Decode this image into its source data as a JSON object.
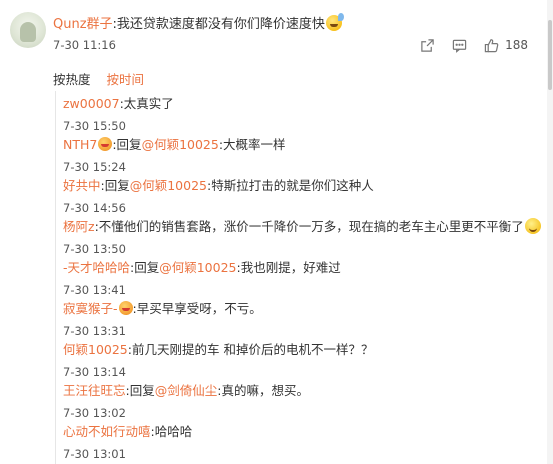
{
  "main_comment": {
    "user": "Qunz群子",
    "text": ":我还贷款速度都没有你们降价速度快",
    "time": "7-30 11:16",
    "likes": "188",
    "emoji": "sweat-grin-emoji"
  },
  "sort": {
    "by_heat": "按热度",
    "by_time": "按时间"
  },
  "replies": [
    {
      "user": "zw00007",
      "pre": ":太真实了",
      "mention": "",
      "text": "",
      "time": "7-30 15:50"
    },
    {
      "user": "NTH7",
      "pre": ":回复",
      "mention": "@何颖10025",
      "text": ":大概率一样",
      "time": "7-30 15:24",
      "badge": "vip-emoji"
    },
    {
      "user": "好共中",
      "pre": ":回复",
      "mention": "@何颖10025",
      "text": ":特斯拉打击的就是你们这种人",
      "time": "7-30 14:56"
    },
    {
      "user": "杨阿z",
      "pre": ":不懂他们的销售套路，涨价一千降价一万多，现在搞的老车主心里更不平衡了",
      "mention": "",
      "text": "",
      "time": "7-30 13:50",
      "emoji": "smile-emoji"
    },
    {
      "user": "-天才哈哈哈",
      "pre": ":回复",
      "mention": "@何颖10025",
      "text": ":我也刚提，好难过",
      "time": "7-30 13:41"
    },
    {
      "user": "寂寞猴子-",
      "pre": ":早买早享受呀，不亏。",
      "mention": "",
      "text": "",
      "time": "7-30 13:31",
      "badge": "vip-emoji"
    },
    {
      "user": "何颖10025",
      "pre": ":前几天刚提的车 和掉价后的电机不一样？？",
      "mention": "",
      "text": "",
      "time": "7-30 13:14"
    },
    {
      "user": "王汪往旺忘",
      "pre": ":回复",
      "mention": "@剑倚仙尘",
      "text": ":真的嘛，想买。",
      "time": "7-30 13:02"
    },
    {
      "user": "心动不如行动嘻",
      "pre": ":哈哈哈",
      "mention": "",
      "text": "",
      "time": "7-30 13:01"
    }
  ],
  "colors": {
    "accent": "#eb7340",
    "text": "#333333",
    "muted": "#555555"
  }
}
